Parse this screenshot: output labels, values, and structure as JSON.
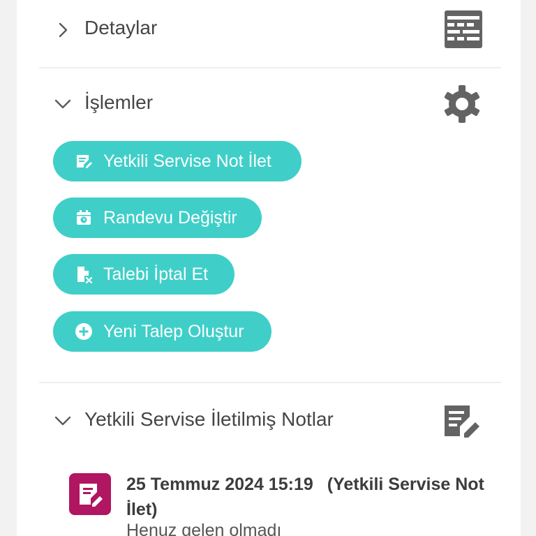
{
  "sections": {
    "details": {
      "title": "Detaylar",
      "icon": "table-grid-icon",
      "state": "collapsed"
    },
    "actions": {
      "title": "İşlemler",
      "icon": "gear-icon",
      "state": "expanded"
    },
    "notes": {
      "title": "Yetkili Servise İletilmiş Notlar",
      "icon": "edit-note-icon",
      "state": "expanded"
    }
  },
  "actions": {
    "send_note": {
      "label": "Yetkili Servise Not İlet",
      "icon": "edit-note-icon"
    },
    "change_appointment": {
      "label": "Randevu Değiştir",
      "icon": "calendar-clock-icon"
    },
    "cancel_request": {
      "label": "Talebi İptal Et",
      "icon": "file-cancel-icon"
    },
    "new_request": {
      "label": "Yeni Talep Oluştur",
      "icon": "plus-circle-icon"
    }
  },
  "notes": [
    {
      "date": "25 Temmuz 2024 15:19",
      "type": "(Yetkili Servise Not İlet)",
      "text": "Henuz gelen olmadı"
    }
  ],
  "colors": {
    "accent": "#3fcfc8",
    "note_badge": "#b01661",
    "icon_gray": "#636363",
    "text": "#454545"
  }
}
